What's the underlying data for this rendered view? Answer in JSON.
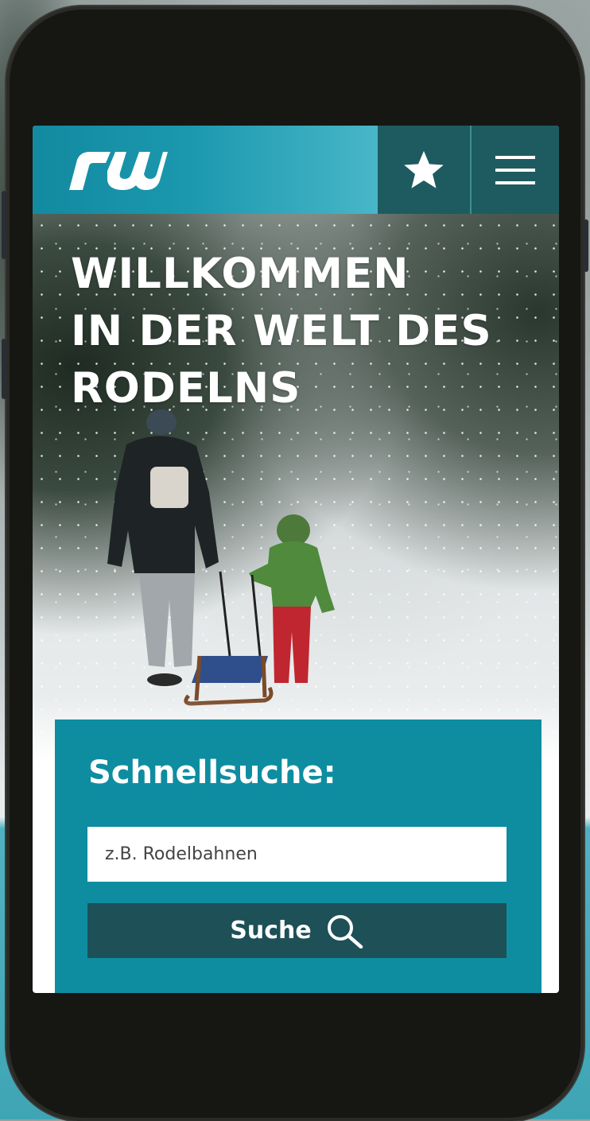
{
  "header": {
    "logo_text": "rw",
    "logo_icon": "rw-logo",
    "favorites_icon": "star-icon",
    "menu_icon": "hamburger-menu-icon"
  },
  "hero": {
    "title_line1": "WILLKOMMEN",
    "title_line2": "IN DER WELT DES",
    "title_line3": "RODELNS"
  },
  "quick_search": {
    "title": "Schnellsuche:",
    "input_value": "",
    "input_placeholder": "z.B. Rodelbahnen",
    "button_label": "Suche",
    "button_icon": "search-icon"
  },
  "colors": {
    "teal": "#0e8da1",
    "dark_teal": "#1d5b60",
    "button_dark": "#1d5057",
    "text_white": "#ffffff"
  }
}
